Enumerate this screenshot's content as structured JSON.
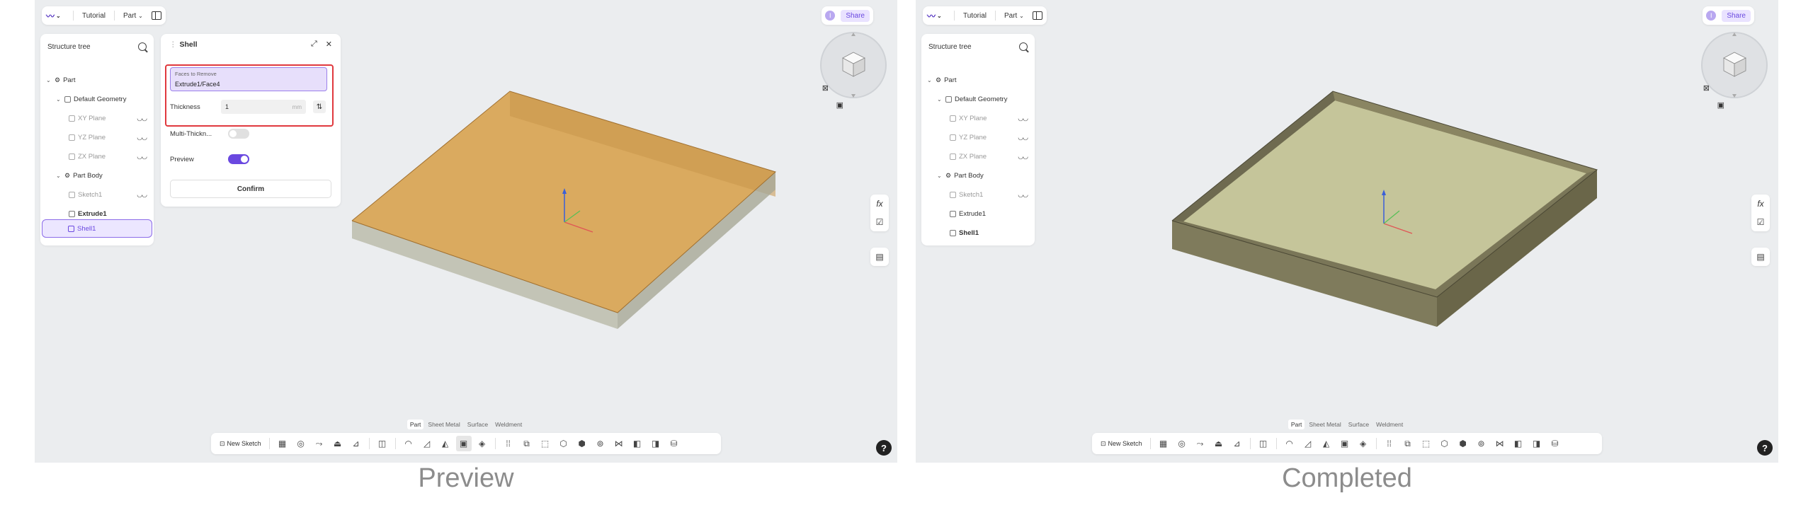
{
  "common": {
    "tutorial": "Tutorial",
    "part_menu": "Part",
    "share": "Share",
    "user_initial": "I",
    "tree_title": "Structure tree",
    "tree": {
      "part": "Part",
      "default_geometry": "Default Geometry",
      "xy": "XY Plane",
      "yz": "YZ Plane",
      "zx": "ZX Plane",
      "part_body": "Part Body",
      "sketch1": "Sketch1",
      "extrude1": "Extrude1",
      "shell1": "Shell1"
    },
    "tabs": [
      "Part",
      "Sheet Metal",
      "Surface",
      "Weldment"
    ],
    "new_sketch": "New Sketch",
    "fx": "fx",
    "help": "?"
  },
  "shell_panel": {
    "title": "Shell",
    "faces_label": "Faces to Remove",
    "faces_value": "Extrude1/Face4",
    "thickness_label": "Thickness",
    "thickness_value": "1",
    "thickness_unit": "mm",
    "multi_label": "Multi-Thickn...",
    "multi_on": false,
    "preview_label": "Preview",
    "preview_on": true,
    "confirm": "Confirm"
  },
  "captions": {
    "left": "Preview",
    "right": "Completed"
  },
  "colors": {
    "accent": "#6a48e0",
    "highlight_red": "#e0393e",
    "preview_fill": "#d9a24f",
    "completed_fill": "#b8b88f"
  }
}
